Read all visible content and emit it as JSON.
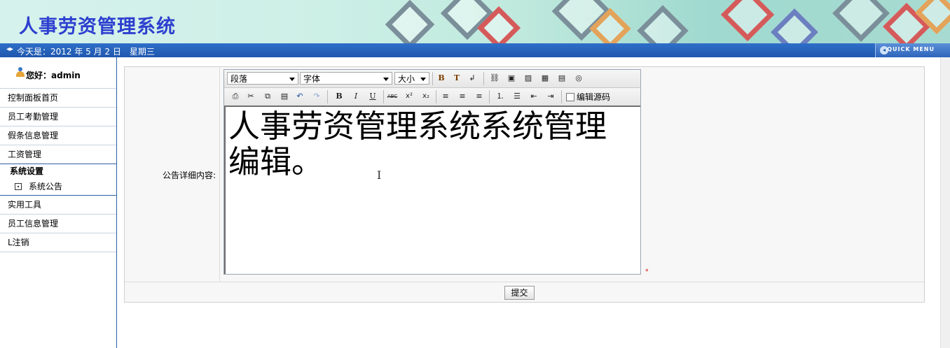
{
  "header": {
    "title": "人事劳资管理系统",
    "date_text": "今天是：2012 年 5 月 2 日　星期三",
    "quick_menu": "QUICK MENU"
  },
  "sidebar": {
    "greeting": "您好：admin",
    "items_top": [
      "控制面板首页",
      "员工考勤管理",
      "假条信息管理",
      "工资管理"
    ],
    "section_title": "系统设置",
    "sub_items": [
      "系统公告"
    ],
    "items_bottom": [
      "实用工具",
      "员工信息管理",
      "L注销"
    ]
  },
  "form": {
    "label": "公告详细内容:",
    "toolbar": {
      "paragraph": "段落",
      "font": "字体",
      "size": "大小",
      "edit_source": "编辑源码"
    },
    "content": "人事劳资管理系统系统管理编辑。",
    "required_mark": "*",
    "submit_label": "提交"
  }
}
